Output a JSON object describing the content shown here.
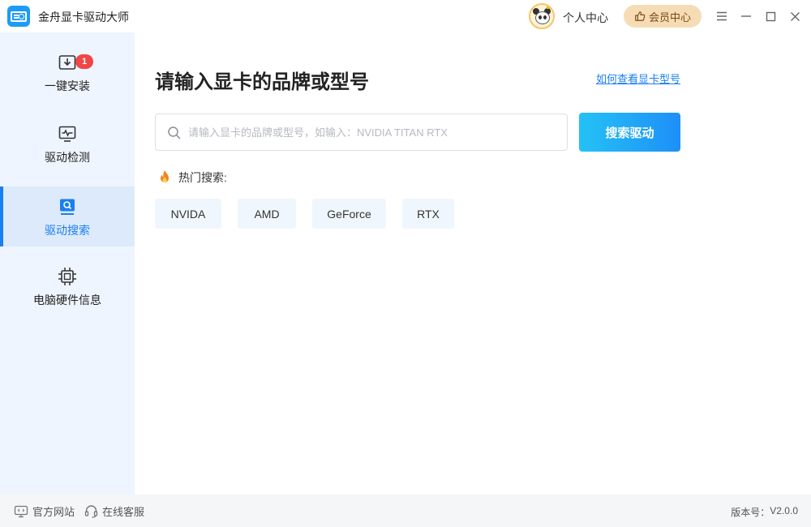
{
  "app": {
    "title": "金舟显卡驱动大师"
  },
  "header": {
    "personal_center": "个人中心",
    "member_center": "会员中心"
  },
  "sidebar": {
    "items": [
      {
        "label": "一键安装",
        "icon": "download-box-icon",
        "badge": "1",
        "active": false
      },
      {
        "label": "驱动检测",
        "icon": "monitor-pulse-icon",
        "active": false
      },
      {
        "label": "驱动搜索",
        "icon": "search-monitor-icon",
        "active": true
      },
      {
        "label": "电脑硬件信息",
        "icon": "chip-icon",
        "active": false
      }
    ]
  },
  "main": {
    "title": "请输入显卡的品牌或型号",
    "help_link": "如何查看显卡型号",
    "search": {
      "placeholder": "请输入显卡的品牌或型号，如输入：NVIDIA TITAN RTX",
      "value": "",
      "button": "搜索驱动"
    },
    "hot_label": "热门搜索:",
    "hot_tags": [
      "NVIDA",
      "AMD",
      "GeForce",
      "RTX"
    ]
  },
  "footer": {
    "official_site": "官方网站",
    "online_service": "在线客服",
    "version_label": "版本号：",
    "version_value": "V2.0.0"
  },
  "colors": {
    "accent": "#1a7ff0",
    "sidebar_bg": "#eff5fe",
    "member_bg": "#f6dcb5",
    "badge": "#f24545"
  }
}
